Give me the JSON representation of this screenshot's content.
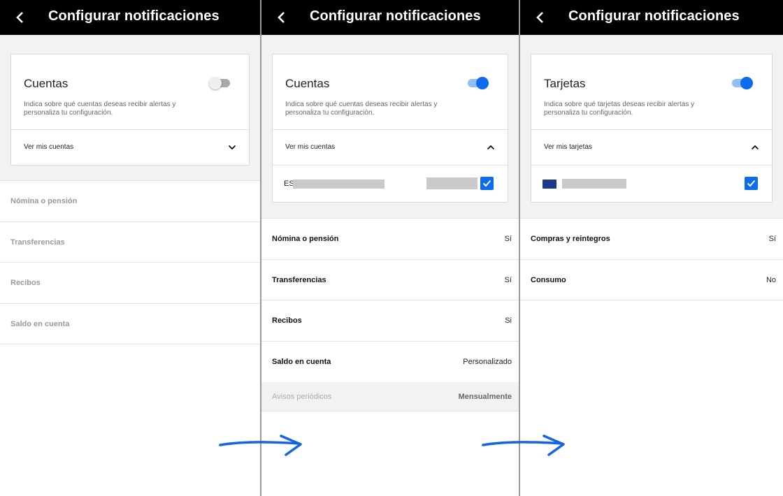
{
  "colors": {
    "accent": "#0b6cf0",
    "topbar": "#000000",
    "arrow": "#1565e0"
  },
  "screens": [
    {
      "title": "Configurar notificaciones",
      "card": {
        "title": "Cuentas",
        "description": "Indica sobre qué cuentas deseas recibir alertas y personaliza tu configuración.",
        "toggle_on": false,
        "expander_label": "Ver mis cuentas"
      },
      "rows": [
        {
          "label": "Nómina o pensión"
        },
        {
          "label": "Transferencias"
        },
        {
          "label": "Recibos"
        },
        {
          "label": "Saldo en cuenta"
        }
      ]
    },
    {
      "title": "Configurar notificaciones",
      "card": {
        "title": "Cuentas",
        "description": "Indica sobre qué cuentas deseas recibir alertas y personaliza tu configuración.",
        "toggle_on": true,
        "expander_label": "Ver mis cuentas",
        "account_prefix": "ES",
        "account_checked": true
      },
      "rows": [
        {
          "label": "Nómina o pensión",
          "value": "Sí"
        },
        {
          "label": "Transferencias",
          "value": "Sí"
        },
        {
          "label": "Recibos",
          "value": "Si"
        },
        {
          "label": "Saldo en cuenta",
          "value": "Personalizado"
        }
      ],
      "subrow": {
        "label": "Avisos periódicos",
        "value": "Mensualmente"
      }
    },
    {
      "title": "Configurar notificaciones",
      "card": {
        "title": "Tarjetas",
        "description": "Indica sobre qué tarjetas deseas recibir alertas y personaliza tu configuración.",
        "toggle_on": true,
        "expander_label": "Ver mis tarjetas",
        "card_checked": true
      },
      "rows": [
        {
          "label": "Compras y reintegros",
          "value": "Sí"
        },
        {
          "label": "Consumo",
          "value": "No"
        }
      ]
    }
  ]
}
